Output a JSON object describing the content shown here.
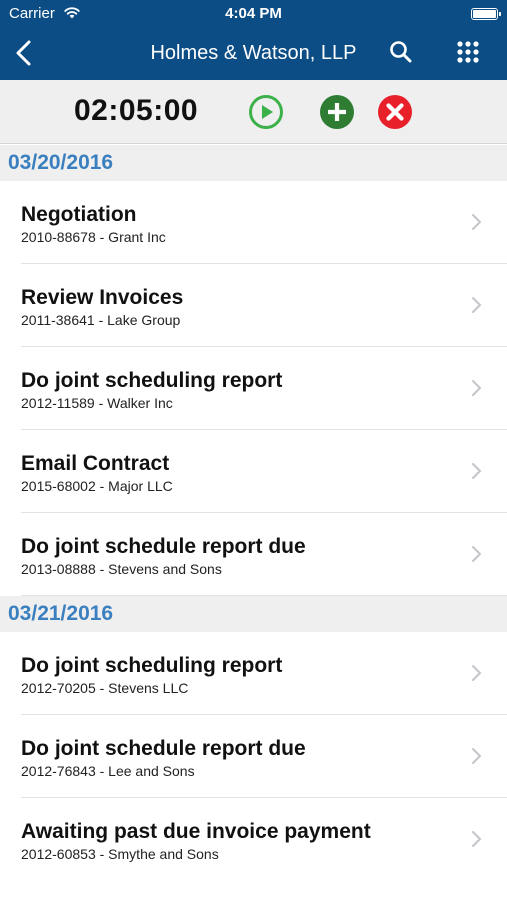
{
  "status_bar": {
    "carrier": "Carrier",
    "time": "4:04 PM",
    "icons": [
      "wifi-icon",
      "battery-icon"
    ]
  },
  "nav": {
    "title": "Holmes & Watson, LLP",
    "icons": [
      "back-chevron-icon",
      "search-icon",
      "apps-grid-icon"
    ]
  },
  "timer": {
    "elapsed": "02:05:00",
    "icons": [
      "play-icon",
      "add-icon",
      "cancel-icon"
    ],
    "colors": {
      "play": "#3cb14a",
      "add": "#2e7d32",
      "cancel": "#e8202a"
    }
  },
  "colors": {
    "header": "#0d4d85",
    "section_text": "#3a7fbf"
  },
  "sections": [
    {
      "date": "03/20/2016",
      "items": [
        {
          "task": "Negotiation",
          "matter": "2010-88678 - Grant Inc"
        },
        {
          "task": "Review Invoices",
          "matter": "2011-38641 - Lake Group"
        },
        {
          "task": "Do joint scheduling report",
          "matter": "2012-11589 - Walker Inc"
        },
        {
          "task": "Email Contract",
          "matter": "2015-68002 - Major LLC"
        },
        {
          "task": "Do joint schedule report due",
          "matter": "2013-08888 - Stevens and Sons"
        }
      ]
    },
    {
      "date": "03/21/2016",
      "items": [
        {
          "task": "Do joint scheduling report",
          "matter": "2012-70205 - Stevens LLC"
        },
        {
          "task": "Do joint schedule report due",
          "matter": "2012-76843 - Lee and Sons"
        },
        {
          "task": "Awaiting past due invoice payment",
          "matter": "2012-60853 - Smythe and Sons"
        }
      ]
    }
  ]
}
